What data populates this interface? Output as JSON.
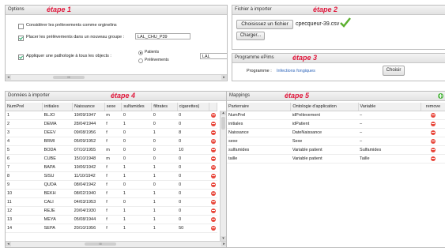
{
  "top_strip": {
    "text": "'"
  },
  "options": {
    "title": "Options",
    "etape": "étape 1",
    "opt1_label": "Considérer les prélevements comme orginelins",
    "opt2_label": "Placer les prélèvements dans un nouveau groupe :",
    "group_name": "LAL_CHU_P39",
    "opt3_label": "Appliquer une pathologie à tous les objects :",
    "radio_patients": "Patients",
    "radio_prelevements": "Prélèvements",
    "pathology_value": "LAL"
  },
  "fichier": {
    "title": "Fichier à importer",
    "etape": "étape 2",
    "choose_button": "Choisissez un fichier",
    "filename": "cpecqueur-39.csv",
    "charger_button": "Charger..."
  },
  "programme": {
    "title": "Programme ePims",
    "etape": "étape 3",
    "label": "Programme :",
    "value": "Infections fongiques",
    "choisir_button": "Choisir"
  },
  "donnees": {
    "title": "Données à importer",
    "etape": "étape 4",
    "columns": [
      "NumPrel",
      "initiales",
      "Naissance",
      "sexe",
      "sulfamides",
      "filtrates",
      "cigarettes)"
    ],
    "rows": [
      [
        "1",
        "BLJO",
        "19/09/1947",
        "m",
        "0",
        "0",
        "0"
      ],
      [
        "2",
        "DEMA",
        "28/04/1944",
        "f",
        "1",
        "0",
        "0"
      ],
      [
        "3",
        "DEEV",
        "09/08/1956",
        "f",
        "0",
        "1",
        "8"
      ],
      [
        "4",
        "BRMI",
        "05/09/1952",
        "f",
        "0",
        "0",
        "0"
      ],
      [
        "5",
        "BODA",
        "07/10/1955",
        "m",
        "0",
        "0",
        "10"
      ],
      [
        "6",
        "CUBE",
        "15/10/1948",
        "m",
        "0",
        "0",
        "0"
      ],
      [
        "7",
        "BAPA",
        "19/06/1942",
        "f",
        "1",
        "1",
        "0"
      ],
      [
        "8",
        "SISU",
        "11/10/1942",
        "f",
        "1",
        "1",
        "0"
      ],
      [
        "9",
        "QUDA",
        "08/04/1942",
        "f",
        "0",
        "0",
        "0"
      ],
      [
        "10",
        "BEKH",
        "08/02/1940",
        "f",
        "1",
        "1",
        "0"
      ],
      [
        "11",
        "CALI",
        "04/03/1953",
        "f",
        "0",
        "1",
        "0"
      ],
      [
        "12",
        "REJE",
        "20/04/1930",
        "f",
        "1",
        "1",
        "0"
      ],
      [
        "13",
        "MEYA",
        "05/08/1944",
        "f",
        "1",
        "1",
        "0"
      ],
      [
        "14",
        "SEPA",
        "20/10/1956",
        "f",
        "1",
        "1",
        "50"
      ]
    ],
    "scroll_marker": "III"
  },
  "mappings": {
    "title": "Mappings",
    "etape": "étape 5",
    "columns": [
      "Parterraire",
      "Ontologie d'application",
      "Variable",
      "remove"
    ],
    "rows": [
      [
        "NumPrel",
        "idPrélevement",
        "–"
      ],
      [
        "initiales",
        "idPatient",
        "–"
      ],
      [
        "Naissance",
        "DateNaissance",
        "–"
      ],
      [
        "sexe",
        "Sexe",
        "–"
      ],
      [
        "sulfamides",
        "Variable patient",
        "Sulfamides"
      ],
      [
        "taille",
        "Variable patient",
        "Taille"
      ]
    ]
  },
  "scroll_marker": "III"
}
